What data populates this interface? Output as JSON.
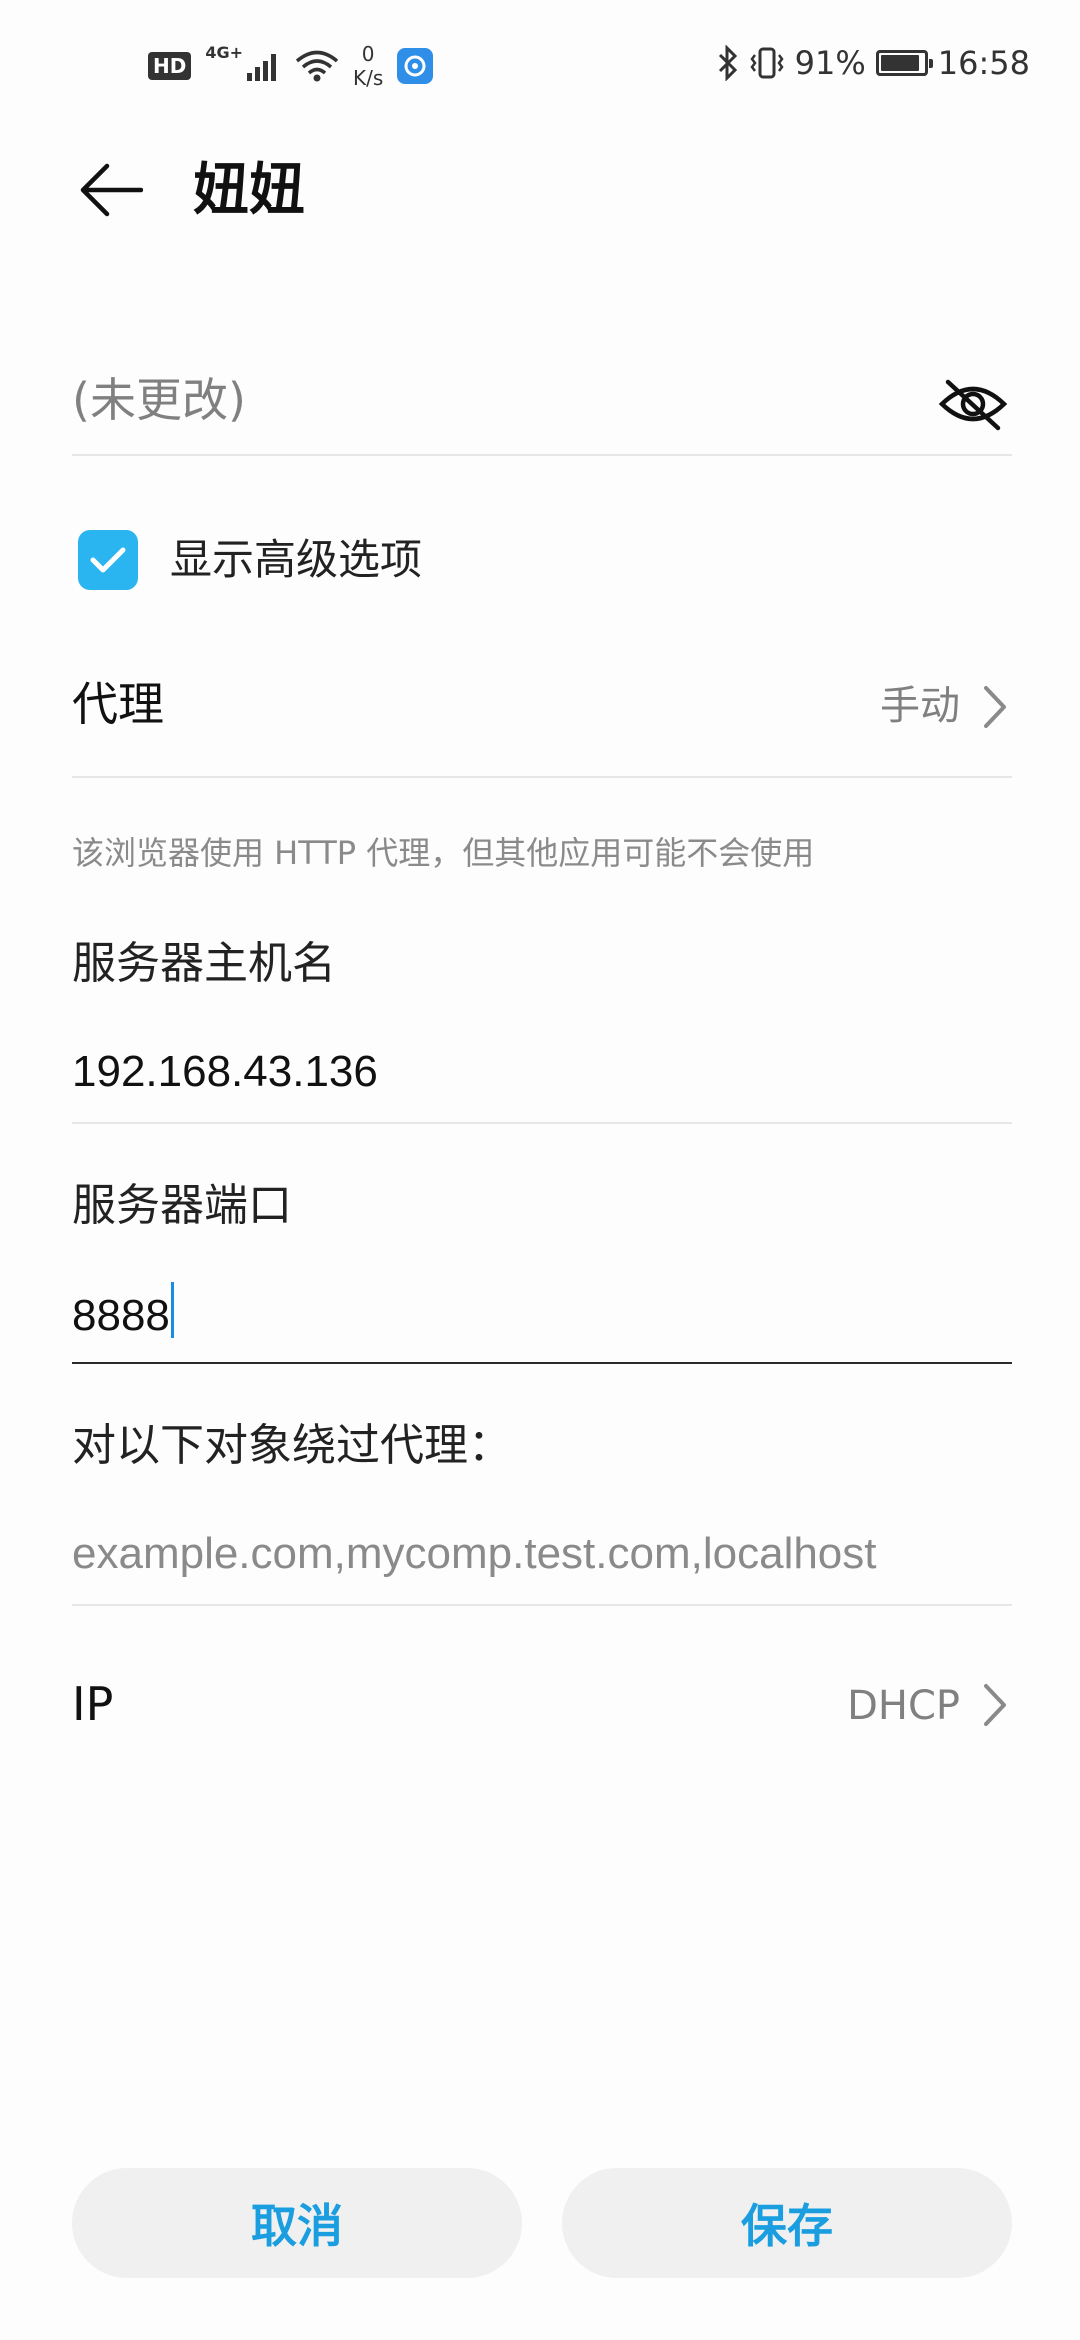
{
  "status_bar": {
    "hd": "HD",
    "network": "4G+",
    "speed_value": "0",
    "speed_unit": "K/s",
    "battery_percent": "91%",
    "battery_level": 0.91,
    "time": "16:58"
  },
  "header": {
    "title": "妞妞"
  },
  "password": {
    "value": "(未更改)"
  },
  "advanced": {
    "label": "显示高级选项",
    "checked": true
  },
  "proxy": {
    "label": "代理",
    "value": "手动",
    "hint": "该浏览器使用 HTTP 代理，但其他应用可能不会使用"
  },
  "host": {
    "label": "服务器主机名",
    "value": "192.168.43.136"
  },
  "port": {
    "label": "服务器端口",
    "value": "8888"
  },
  "bypass": {
    "label": "对以下对象绕过代理：",
    "placeholder": "example.com,mycomp.test.com,localhost"
  },
  "ip": {
    "label": "IP",
    "value": "DHCP"
  },
  "buttons": {
    "cancel": "取消",
    "save": "保存"
  },
  "colors": {
    "accent": "#1a9ee0",
    "checkbox": "#2ab4f0"
  }
}
